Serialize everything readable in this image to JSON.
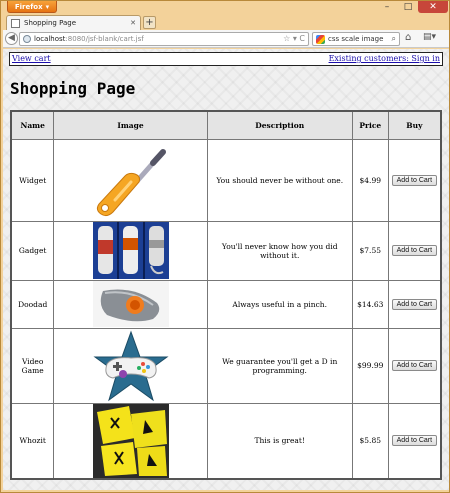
{
  "browser": {
    "app_button": "Firefox",
    "tab_title": "Shopping Page",
    "url_host": "localhost",
    "url_rest": ":8080/jsf-blank/cart.jsf",
    "search_value": "css scale image",
    "accent": "#e67312"
  },
  "page": {
    "view_cart": "View cart",
    "sign_in": "Existing customers: Sign in",
    "title": "Shopping Page"
  },
  "table": {
    "headers": [
      "Name",
      "Image",
      "Description",
      "Price",
      "Buy"
    ],
    "rows": [
      {
        "name": "Widget",
        "description": "You should never be without one.",
        "price": "$4.99",
        "buy": "Add to Cart"
      },
      {
        "name": "Gadget",
        "description": "You'll never know how you did without it.",
        "price": "$7.55",
        "buy": "Add to Cart"
      },
      {
        "name": "Doodad",
        "description": "Always useful in a pinch.",
        "price": "$14.63",
        "buy": "Add to Cart"
      },
      {
        "name": "Video Game",
        "description": "We guarantee you'll get a D in programming.",
        "price": "$99.99",
        "buy": "Add to Cart"
      },
      {
        "name": "Whozit",
        "description": "This is great!",
        "price": "$5.85",
        "buy": "Add to Cart"
      }
    ]
  }
}
